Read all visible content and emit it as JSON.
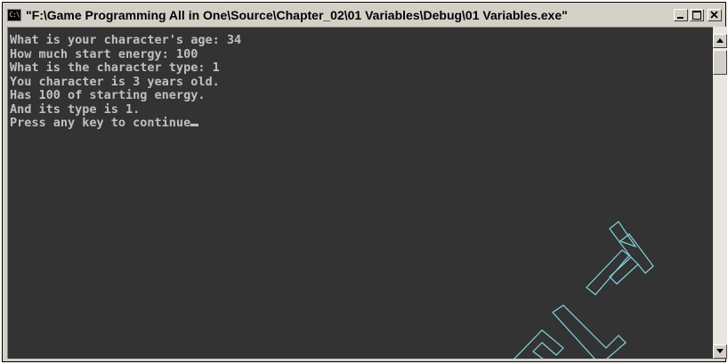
{
  "window": {
    "title": "\"F:\\Game Programming All in One\\Source\\Chapter_02\\01 Variables\\Debug\\01 Variables.exe\"",
    "icon": "console-icon",
    "icon_glyph": "C:\\"
  },
  "console": {
    "lines": [
      "What is your character's age: 34",
      "How much start energy: 100",
      "What is the character type: 1",
      "You character is 3 years old.",
      "Has 100 of starting energy.",
      "And its type is 1.",
      "Press any key to continue"
    ],
    "background": "#333333",
    "foreground": "#c0c0c0"
  },
  "scrollbar": {
    "up_icon": "arrow-up-icon",
    "down_icon": "arrow-down-icon"
  },
  "colors": {
    "chrome": "#d4d0c8",
    "watermark": "#7fd4e0"
  }
}
